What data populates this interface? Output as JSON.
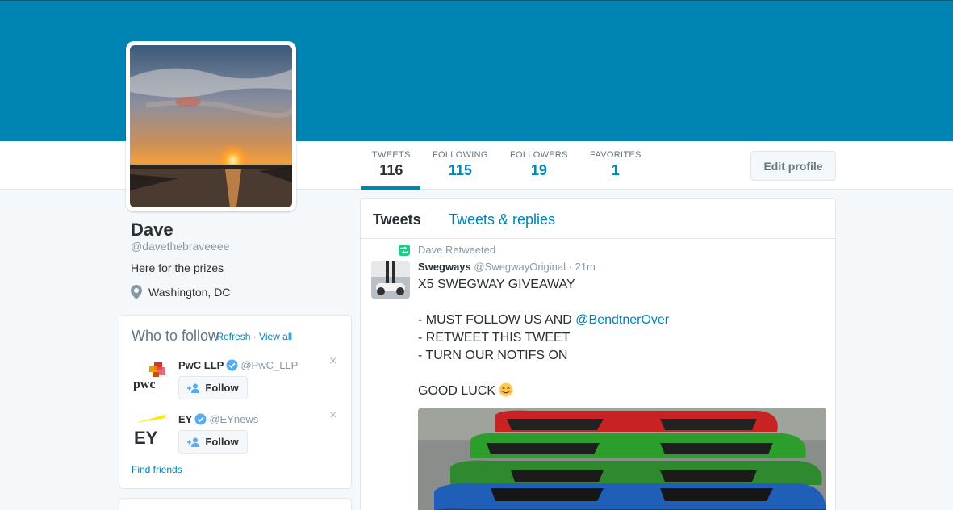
{
  "colors": {
    "banner": "#0084b4",
    "link": "#0084b4",
    "text": "#292f33",
    "muted": "#8899a6",
    "retweet_green": "#19cf86"
  },
  "profile": {
    "name": "Dave",
    "handle": "@davethebraveeee",
    "bio": "Here for the prizes",
    "location": "Washington, DC",
    "location_icon": "map-pin-icon"
  },
  "nav": {
    "stats": [
      {
        "label": "TWEETS",
        "value": "116"
      },
      {
        "label": "FOLLOWING",
        "value": "115"
      },
      {
        "label": "FOLLOWERS",
        "value": "19"
      },
      {
        "label": "FAVORITES",
        "value": "1"
      }
    ],
    "edit_label": "Edit profile"
  },
  "who_to_follow": {
    "title": "Who to follow",
    "sep": " · ",
    "refresh": "Refresh",
    "view_all": "View all",
    "follow_label": "Follow",
    "close_glyph": "×",
    "find_friends": "Find friends",
    "accounts": [
      {
        "name": "PwC LLP",
        "handle": "@PwC_LLP",
        "logo_text": "pwc"
      },
      {
        "name": "EY",
        "handle": "@EYnews",
        "logo_text": "EY"
      }
    ]
  },
  "timeline": {
    "tabs": [
      "Tweets",
      "Tweets & replies"
    ],
    "tweet": {
      "retweet_label": "Dave Retweeted",
      "author": "Swegways",
      "handle": "@SwegwayOriginal",
      "time": "· 21m",
      "lines": {
        "l1": "X5 SWEGWAY GIVEAWAY",
        "l2_prefix": "- MUST FOLLOW US AND ",
        "l2_mention": "@BendtnerOver",
        "l3": "- RETWEET THIS TWEET",
        "l4": "- TURN OUR NOTIFS ON",
        "l5": "GOOD LUCK"
      },
      "emoji": "smiling-face-emoji"
    }
  }
}
